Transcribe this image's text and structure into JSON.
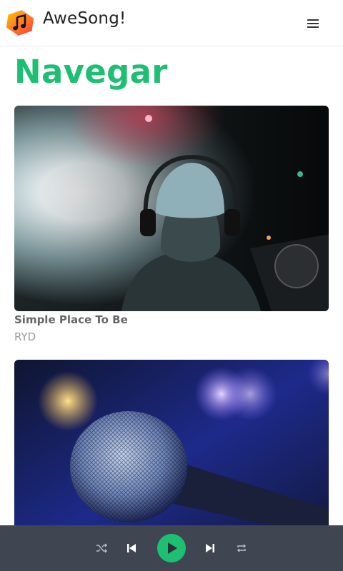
{
  "app": {
    "title": "AweSong!",
    "logo_icon": "music-note-icon",
    "menu_icon": "hamburger-menu-icon"
  },
  "page": {
    "title": "Navegar"
  },
  "songs": [
    {
      "title": "Simple Place To Be",
      "artist": "RYD",
      "image": "dj-with-headphones-photo"
    },
    {
      "title": "",
      "artist": "",
      "image": "microphone-photo"
    }
  ],
  "player": {
    "controls": [
      "shuffle-icon",
      "previous-icon",
      "play-icon",
      "next-icon",
      "repeat-icon"
    ]
  },
  "colors": {
    "accent": "#1dbf73",
    "player_bar": "#3f4652",
    "logo_gradient_top": "#ffb300",
    "logo_gradient_bottom": "#ff3d3d"
  }
}
